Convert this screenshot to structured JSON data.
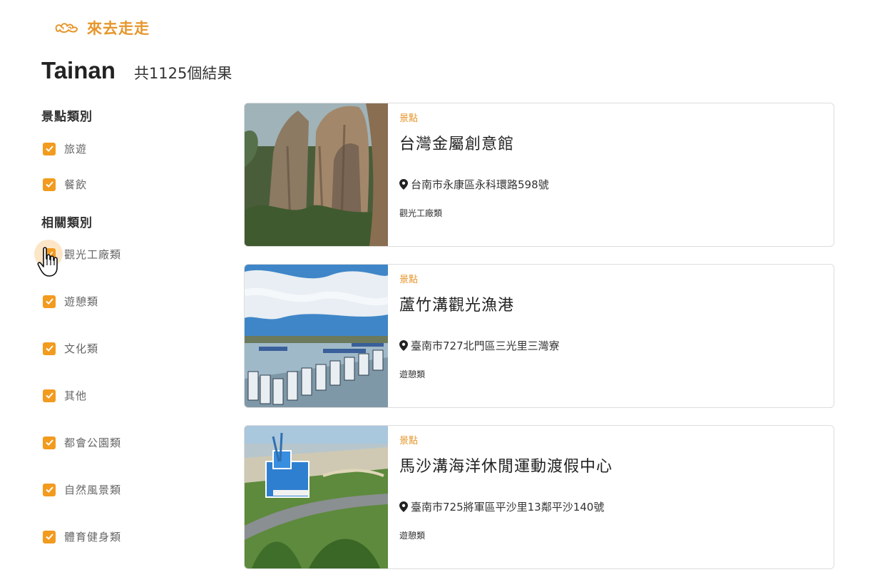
{
  "brand": {
    "name": "來去走走",
    "logo_icon": "cloud-ornament-icon"
  },
  "heading": {
    "city": "Tainan",
    "result_count": "共1125個結果"
  },
  "filters": {
    "attraction_category": {
      "title": "景點類別",
      "options": [
        {
          "label": "旅遊",
          "checked": true
        },
        {
          "label": "餐飲",
          "checked": true
        }
      ]
    },
    "related_category": {
      "title": "相關類別",
      "options": [
        {
          "label": "觀光工廠類",
          "checked": true
        },
        {
          "label": "遊憩類",
          "checked": true
        },
        {
          "label": "文化類",
          "checked": true
        },
        {
          "label": "其他",
          "checked": true
        },
        {
          "label": "都會公園類",
          "checked": true
        },
        {
          "label": "自然風景類",
          "checked": true
        },
        {
          "label": "體育健身類",
          "checked": true
        }
      ]
    }
  },
  "results": [
    {
      "type": "景點",
      "title": "台灣金屬創意館",
      "address": "台南市永康區永科環路598號",
      "tag": "觀光工廠類",
      "image": "rock-cliff-photo"
    },
    {
      "type": "景點",
      "title": "蘆竹溝觀光漁港",
      "address": "臺南市727北門區三光里三灣寮",
      "tag": "遊憩類",
      "image": "fishing-harbor-photo"
    },
    {
      "type": "景點",
      "title": "馬沙溝海洋休閒運動渡假中心",
      "address": "臺南市725將軍區平沙里13鄰平沙140號",
      "tag": "遊憩類",
      "image": "seaside-resort-photo"
    }
  ],
  "colors": {
    "accent": "#e6962c",
    "checkbox": "#f29b1f"
  }
}
